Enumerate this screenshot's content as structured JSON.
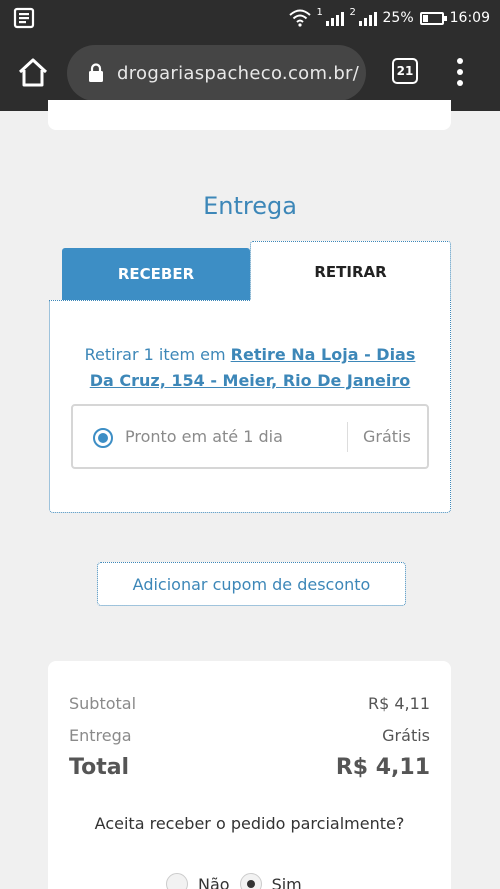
{
  "status_bar": {
    "battery_percent": "25%",
    "battery_level": 0.25,
    "time": "16:09",
    "sim1": "1",
    "sim2": "2",
    "icons": [
      "notification-icon",
      "wifi-icon",
      "signal-icon",
      "battery-icon"
    ]
  },
  "browser": {
    "url": "drogariaspacheco.com.br/",
    "tab_count": "21",
    "icons": [
      "home-icon",
      "lock-icon",
      "tabs-icon",
      "more-menu-icon"
    ]
  },
  "delivery": {
    "title": "Entrega",
    "tabs": [
      {
        "label": "RECEBER",
        "active": false
      },
      {
        "label": "RETIRAR",
        "active": true
      }
    ],
    "pickup_prefix": "Retirar 1 item em",
    "pickup_store": "Retire Na Loja - Dias Da Cruz, 154 - Meier, Rio De Janeiro",
    "option": {
      "label": "Pronto em até 1 dia",
      "price": "Grátis",
      "selected": true
    }
  },
  "coupon": {
    "label": "Adicionar cupom de desconto"
  },
  "summary": {
    "subtotal_label": "Subtotal",
    "subtotal_value": "R$ 4,11",
    "delivery_label": "Entrega",
    "delivery_value": "Grátis",
    "total_label": "Total",
    "total_value": "R$ 4,11",
    "partial_question": "Aceita receber o pedido parcialmente?",
    "options": [
      {
        "label": "Não",
        "selected": false
      },
      {
        "label": "Sim",
        "selected": true
      }
    ]
  },
  "colors": {
    "accent": "#3d87b8",
    "tab_active_bg": "#3d8ec5",
    "chrome_bg": "#2d2d2d",
    "page_bg": "#f0f0f0"
  }
}
